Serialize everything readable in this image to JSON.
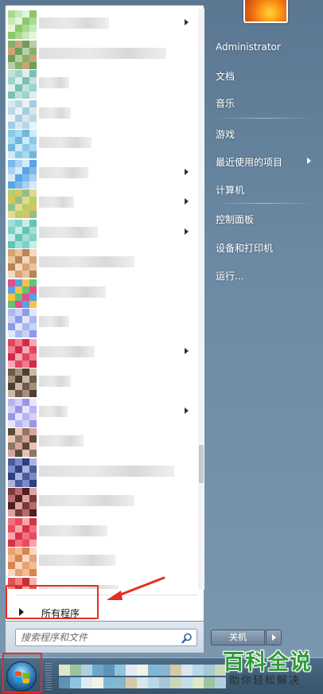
{
  "start_menu": {
    "all_programs_label": "所有程序",
    "search": {
      "placeholder": "搜索程序和文件"
    },
    "right_pane": {
      "items": [
        {
          "label": "Administrator",
          "has_submenu": false
        },
        {
          "label": "文档",
          "has_submenu": false
        },
        {
          "label": "音乐",
          "has_submenu": false
        },
        {
          "label": "游戏",
          "has_submenu": false
        },
        {
          "label": "最近使用的项目",
          "has_submenu": true
        },
        {
          "label": "计算机",
          "has_submenu": false
        },
        {
          "label": "控制面板",
          "has_submenu": false
        },
        {
          "label": "设备和打印机",
          "has_submenu": false
        },
        {
          "label": "运行...",
          "has_submenu": false
        }
      ]
    },
    "shutdown_label": "关机",
    "program_list": {
      "note_blurred": true,
      "items": [
        {
          "has_submenu": true
        },
        {
          "has_submenu": false
        },
        {
          "has_submenu": false
        },
        {
          "has_submenu": false
        },
        {
          "has_submenu": false
        },
        {
          "has_submenu": true
        },
        {
          "has_submenu": true
        },
        {
          "has_submenu": true
        },
        {
          "has_submenu": false
        },
        {
          "has_submenu": false
        },
        {
          "has_submenu": false
        },
        {
          "has_submenu": true
        },
        {
          "has_submenu": false
        },
        {
          "has_submenu": true
        },
        {
          "has_submenu": false
        },
        {
          "has_submenu": false
        },
        {
          "has_submenu": false
        },
        {
          "has_submenu": false
        },
        {
          "has_submenu": false
        },
        {
          "has_submenu": false
        }
      ]
    }
  },
  "watermark": {
    "main": "百科全说",
    "sub": "助你轻松解决"
  },
  "colors": {
    "highlight_red": "#e62d22",
    "watermark_green": "#2e9b3a",
    "menu_blue": "#6c8aa4"
  },
  "icons": {
    "start": "windows-start-orb-icon",
    "search": "magnifier-icon",
    "user": "flower-user-picture-icon"
  }
}
